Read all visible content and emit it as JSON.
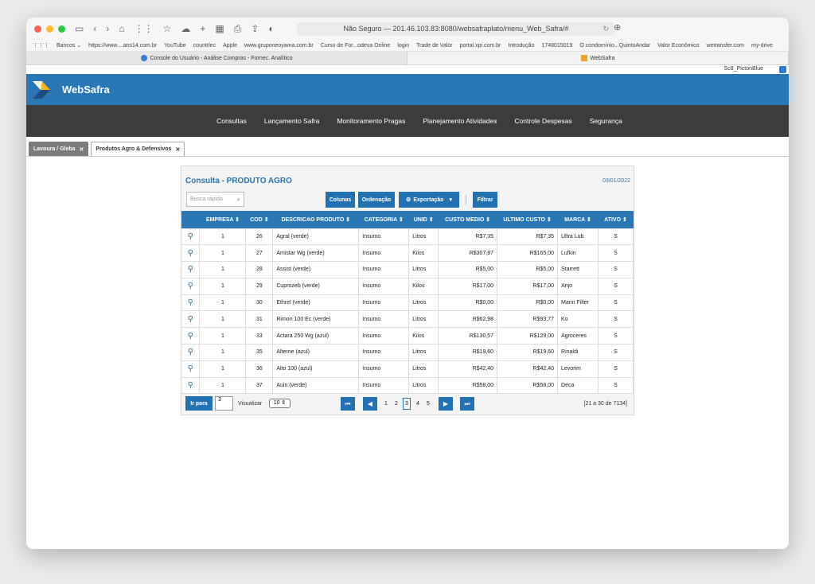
{
  "browser": {
    "address": "Não Seguro — 201.46.103.83:8080/websafraplato/menu_Web_Safra/#",
    "bookmarks": [
      "Bancos ⌄",
      "https://www....ans14.com.br",
      "YouTube",
      "countrlec",
      "Apple",
      "www.gruponeoyama.com.br",
      "Curso de For...odeva Online",
      "login",
      "Trade de Valor",
      "portal.xpi.com.br",
      "Introdução",
      "1748015019",
      "O condomínio...QuintoAndar",
      "Valor Econômico",
      "wetransfer.com",
      "my-drive"
    ],
    "tabs": [
      {
        "label": "Console do Usuário - Análise Compras - Fornec. Analítico",
        "active": false
      },
      {
        "label": "WebSafra",
        "active": true
      }
    ],
    "skin": "Sc8_PictonBlue"
  },
  "brand": {
    "name": "WebSafra"
  },
  "nav": {
    "items": [
      "Consultas",
      "Lançamento Safra",
      "Monitoramento Pragas",
      "Planejamento Atividades",
      "Controle Despesas",
      "Segurança"
    ]
  },
  "app_tabs": [
    {
      "label": "Lavoura / Gleba",
      "active": false
    },
    {
      "label": "Produtos Agro & Defensivos",
      "active": true
    }
  ],
  "panel": {
    "title": "Consulta - PRODUTO AGRO",
    "date": "03/01/2022",
    "search_placeholder": "Busca rápida",
    "buttons": {
      "colunas": "Colunas",
      "ordenacao": "Ordenação",
      "exportacao": "Exportação",
      "filtrar": "Filtrar"
    }
  },
  "table": {
    "headers": [
      "EMPRESA",
      "COD",
      "DESCRICAO PRODUTO",
      "CATEGORIA",
      "UNID",
      "CUSTO MEDIO",
      "ULTIMO CUSTO",
      "MARCA",
      "ATIVO"
    ],
    "rows": [
      [
        "1",
        "26",
        "Agral (verde)",
        "Insumo",
        "Litros",
        "R$7,35",
        "R$7,35",
        "Ultra Lub",
        "S"
      ],
      [
        "1",
        "27",
        "Amistar Wg (verde)",
        "Insumo",
        "Kilos",
        "R$307,87",
        "R$165,00",
        "Lufkin",
        "S"
      ],
      [
        "1",
        "28",
        "Assist (verde)",
        "Insumo",
        "Litros",
        "R$5,00",
        "R$5,00",
        "Starrett",
        "S"
      ],
      [
        "1",
        "29",
        "Cuprozeb (verde)",
        "Insumo",
        "Kilos",
        "R$17,00",
        "R$17,00",
        "Anjo",
        "S"
      ],
      [
        "1",
        "30",
        "Ethrel (verde)",
        "Insumo",
        "Litros",
        "R$0,00",
        "R$0,00",
        "Mann Filter",
        "S"
      ],
      [
        "1",
        "31",
        "Rimon 100 Ec (verde)",
        "Insumo",
        "Litros",
        "R$62,98",
        "R$93,77",
        "Ko",
        "S"
      ],
      [
        "1",
        "33",
        "Actara 250 Wg (azul)",
        "Insumo",
        "Kilos",
        "R$130,57",
        "R$129,00",
        "Agroceres",
        "S"
      ],
      [
        "1",
        "35",
        "Alterne (azul)",
        "Insumo",
        "Litros",
        "R$19,60",
        "R$19,60",
        "Rinaldi",
        "S"
      ],
      [
        "1",
        "36",
        "Alto 100 (azul)",
        "Insumo",
        "Litros",
        "R$42,40",
        "R$42,40",
        "Levorim",
        "S"
      ],
      [
        "1",
        "37",
        "Auin (verde)",
        "Insumo",
        "Litros",
        "R$58,00",
        "R$58,00",
        "Deca",
        "S"
      ]
    ]
  },
  "pager": {
    "go_label": "Ir para",
    "go_value": "3",
    "view_label": "Visualizar",
    "page_size": "10 ⇕",
    "pages": [
      "1",
      "2",
      "3",
      "4",
      "5"
    ],
    "current": "3",
    "range": "[21 a 30 de 7134]"
  }
}
